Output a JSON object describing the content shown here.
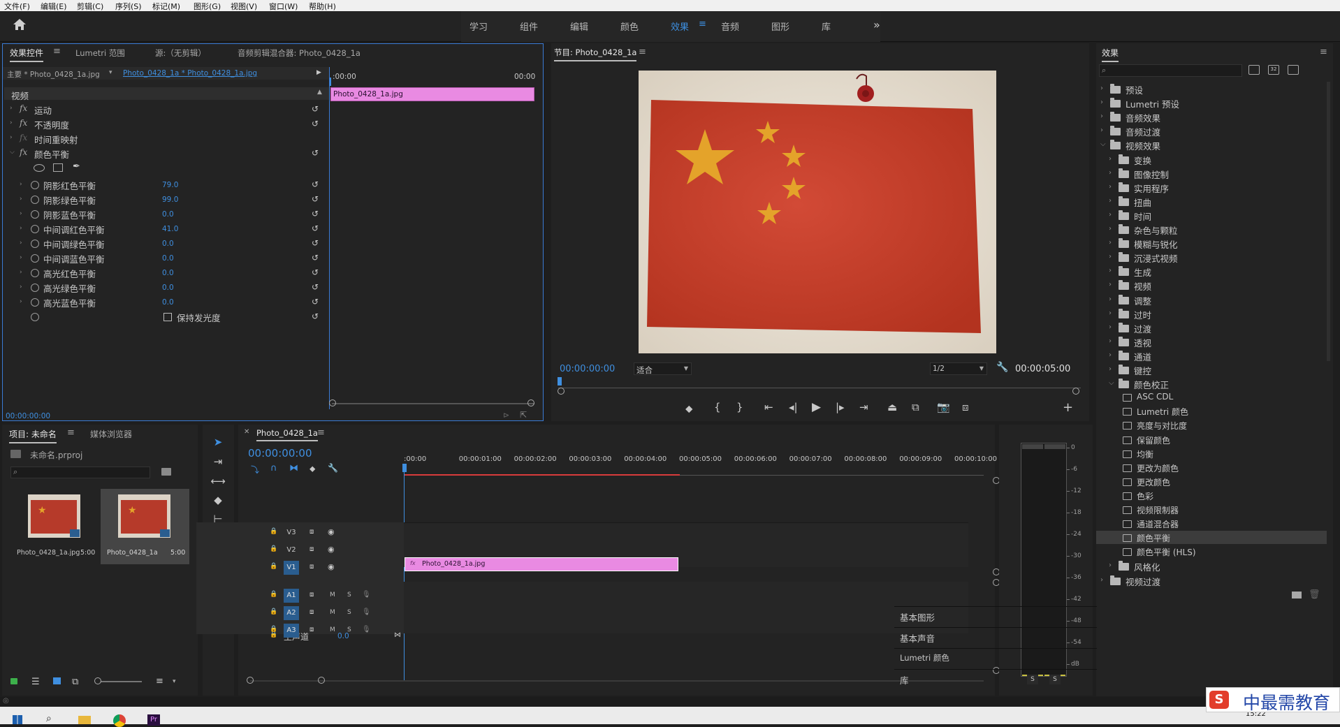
{
  "menu": [
    "文件(F)",
    "编辑(E)",
    "剪辑(C)",
    "序列(S)",
    "标记(M)",
    "图形(G)",
    "视图(V)",
    "窗口(W)",
    "帮助(H)"
  ],
  "workspaces": [
    {
      "label": "学习"
    },
    {
      "label": "组件"
    },
    {
      "label": "编辑"
    },
    {
      "label": "颜色"
    },
    {
      "label": "效果",
      "active": true
    },
    {
      "label": "音频"
    },
    {
      "label": "图形"
    },
    {
      "label": "库"
    }
  ],
  "workspace_more": "»",
  "effect_controls": {
    "tabs": [
      "效果控件",
      "Lumetri 范围",
      "源:（无剪辑）",
      "音频剪辑混合器: Photo_0428_1a"
    ],
    "master_label": "主要 * Photo_0428_1a.jpg",
    "clip_label": "Photo_0428_1a * Photo_0428_1a.jpg",
    "time_start": ":00:00",
    "time_end": "00:00",
    "section_video": "视频",
    "clip_bar": "Photo_0428_1a.jpg",
    "effects": [
      "运动",
      "不透明度",
      "时间重映射",
      "颜色平衡"
    ],
    "params": [
      {
        "name": "阴影红色平衡",
        "value": "79.0"
      },
      {
        "name": "阴影绿色平衡",
        "value": "99.0"
      },
      {
        "name": "阴影蓝色平衡",
        "value": "0.0"
      },
      {
        "name": "中间调红色平衡",
        "value": "41.0"
      },
      {
        "name": "中间调绿色平衡",
        "value": "0.0"
      },
      {
        "name": "中间调蓝色平衡",
        "value": "0.0"
      },
      {
        "name": "高光红色平衡",
        "value": "0.0"
      },
      {
        "name": "高光绿色平衡",
        "value": "0.0"
      },
      {
        "name": "高光蓝色平衡",
        "value": "0.0"
      }
    ],
    "preserve_label": "保持发光度",
    "footer_time": "00:00:00:00"
  },
  "program": {
    "title": "节目: Photo_0428_1a",
    "timecode": "00:00:00:00",
    "fit": "适合",
    "resolution": "1/2",
    "duration": "00:00:05:00"
  },
  "project": {
    "tabs": [
      "项目: 未命名",
      "媒体浏览器"
    ],
    "file": "未命名.prproj",
    "items": [
      {
        "name": "Photo_0428_1a.jpg",
        "dur": "5:00"
      },
      {
        "name": "Photo_0428_1a",
        "dur": "5:00"
      }
    ]
  },
  "timeline": {
    "tab": "Photo_0428_1a",
    "timecode": "00:00:00:00",
    "ruler": [
      ":00:00",
      "00:00:01:00",
      "00:00:02:00",
      "00:00:03:00",
      "00:00:04:00",
      "00:00:05:00",
      "00:00:06:00",
      "00:00:07:00",
      "00:00:08:00",
      "00:00:09:00",
      "00:00:10:00",
      "0"
    ],
    "video_tracks": [
      "V3",
      "V2",
      "V1"
    ],
    "audio_tracks": [
      "A1",
      "A2",
      "A3"
    ],
    "master_label": "主声道",
    "master_value": "0.0",
    "clip": "Photo_0428_1a.jpg",
    "m": "M",
    "s": "S"
  },
  "meter": {
    "labels": [
      "0",
      "-6",
      "-12",
      "-18",
      "-24",
      "-30",
      "-36",
      "-42",
      "-48",
      "-54",
      "dB"
    ],
    "solo": [
      "S",
      "S"
    ]
  },
  "effects_panel": {
    "title": "效果",
    "tree": [
      {
        "label": "预设",
        "level": 0,
        "type": "folder"
      },
      {
        "label": "Lumetri 预设",
        "level": 0,
        "type": "folder"
      },
      {
        "label": "音频效果",
        "level": 0,
        "type": "folder"
      },
      {
        "label": "音频过渡",
        "level": 0,
        "type": "folder"
      },
      {
        "label": "视频效果",
        "level": 0,
        "type": "folder",
        "open": true
      },
      {
        "label": "变换",
        "level": 1,
        "type": "folder"
      },
      {
        "label": "图像控制",
        "level": 1,
        "type": "folder"
      },
      {
        "label": "实用程序",
        "level": 1,
        "type": "folder"
      },
      {
        "label": "扭曲",
        "level": 1,
        "type": "folder"
      },
      {
        "label": "时间",
        "level": 1,
        "type": "folder"
      },
      {
        "label": "杂色与颗粒",
        "level": 1,
        "type": "folder"
      },
      {
        "label": "模糊与锐化",
        "level": 1,
        "type": "folder"
      },
      {
        "label": "沉浸式视频",
        "level": 1,
        "type": "folder"
      },
      {
        "label": "生成",
        "level": 1,
        "type": "folder"
      },
      {
        "label": "视频",
        "level": 1,
        "type": "folder"
      },
      {
        "label": "调整",
        "level": 1,
        "type": "folder"
      },
      {
        "label": "过时",
        "level": 1,
        "type": "folder"
      },
      {
        "label": "过渡",
        "level": 1,
        "type": "folder"
      },
      {
        "label": "透视",
        "level": 1,
        "type": "folder"
      },
      {
        "label": "通道",
        "level": 1,
        "type": "folder"
      },
      {
        "label": "键控",
        "level": 1,
        "type": "folder"
      },
      {
        "label": "颜色校正",
        "level": 1,
        "type": "folder",
        "open": true
      },
      {
        "label": "ASC CDL",
        "level": 2,
        "type": "effect"
      },
      {
        "label": "Lumetri 颜色",
        "level": 2,
        "type": "effect"
      },
      {
        "label": "亮度与对比度",
        "level": 2,
        "type": "effect"
      },
      {
        "label": "保留颜色",
        "level": 2,
        "type": "effect"
      },
      {
        "label": "均衡",
        "level": 2,
        "type": "effect"
      },
      {
        "label": "更改为颜色",
        "level": 2,
        "type": "effect"
      },
      {
        "label": "更改颜色",
        "level": 2,
        "type": "effect"
      },
      {
        "label": "色彩",
        "level": 2,
        "type": "effect"
      },
      {
        "label": "视频限制器",
        "level": 2,
        "type": "effect"
      },
      {
        "label": "通道混合器",
        "level": 2,
        "type": "effect"
      },
      {
        "label": "颜色平衡",
        "level": 2,
        "type": "effect",
        "selected": true
      },
      {
        "label": "颜色平衡 (HLS)",
        "level": 2,
        "type": "effect"
      },
      {
        "label": "风格化",
        "level": 1,
        "type": "folder"
      },
      {
        "label": "视频过渡",
        "level": 0,
        "type": "folder"
      }
    ],
    "collapsed": [
      "基本图形",
      "基本声音",
      "Lumetri 颜色",
      "库"
    ]
  },
  "watermark": {
    "text": "中最需教育"
  },
  "clock": "15:22",
  "colors": {
    "accent": "#3f8fe0",
    "clip": "#e98ae2",
    "flag": "#c63c2b",
    "star": "#e4a32a"
  }
}
